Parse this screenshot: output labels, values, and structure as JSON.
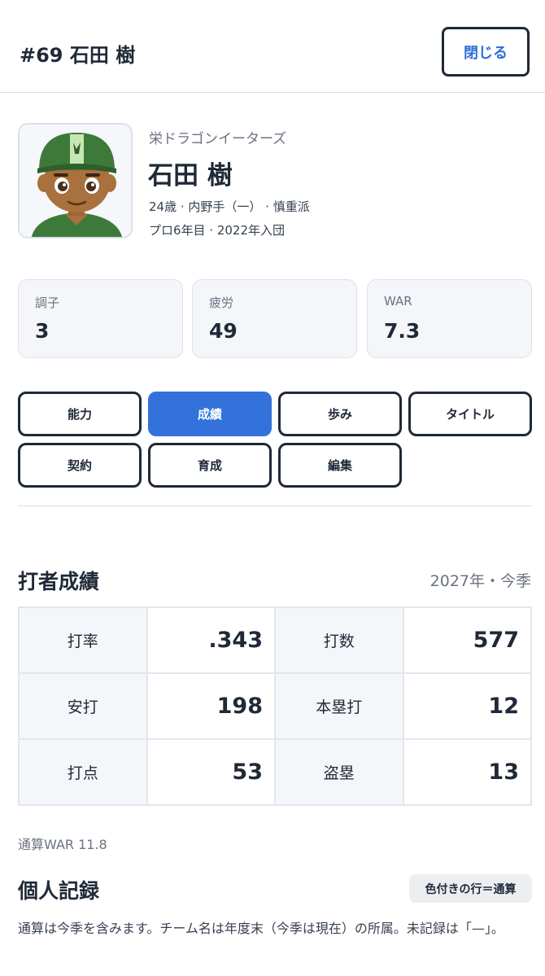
{
  "header": {
    "title": "#69 石田 樹",
    "close_label": "閉じる"
  },
  "profile": {
    "team": "栄ドラゴンイーターズ",
    "name": "石田 樹",
    "meta_line1": "24歳 · 内野手（一） · 慎重派",
    "meta_line2": "プロ6年目 · 2022年入団"
  },
  "summary": [
    {
      "label": "調子",
      "value": "3"
    },
    {
      "label": "疲労",
      "value": "49"
    },
    {
      "label": "WAR",
      "value": "7.3"
    }
  ],
  "tabs": [
    {
      "label": "能力",
      "active": false
    },
    {
      "label": "成績",
      "active": true
    },
    {
      "label": "歩み",
      "active": false
    },
    {
      "label": "タイトル",
      "active": false
    },
    {
      "label": "契約",
      "active": false
    },
    {
      "label": "育成",
      "active": false
    },
    {
      "label": "編集",
      "active": false
    }
  ],
  "batting": {
    "title": "打者成績",
    "season": "2027年・今季",
    "rows": [
      [
        {
          "label": "打率",
          "value": ".343"
        },
        {
          "label": "打数",
          "value": "577"
        }
      ],
      [
        {
          "label": "安打",
          "value": "198"
        },
        {
          "label": "本塁打",
          "value": "12"
        }
      ],
      [
        {
          "label": "打点",
          "value": "53"
        },
        {
          "label": "盗塁",
          "value": "13"
        }
      ]
    ],
    "total_war": "通算WAR 11.8"
  },
  "records": {
    "title": "個人記録",
    "legend": "色付きの行＝通算",
    "note": "通算は今季を含みます。チーム名は年度末（今季は現在）の所属。未記録は「—」。"
  },
  "colors": {
    "accent": "#3372db",
    "cap_green": "#3d7a3a",
    "skin": "#a8713d"
  }
}
